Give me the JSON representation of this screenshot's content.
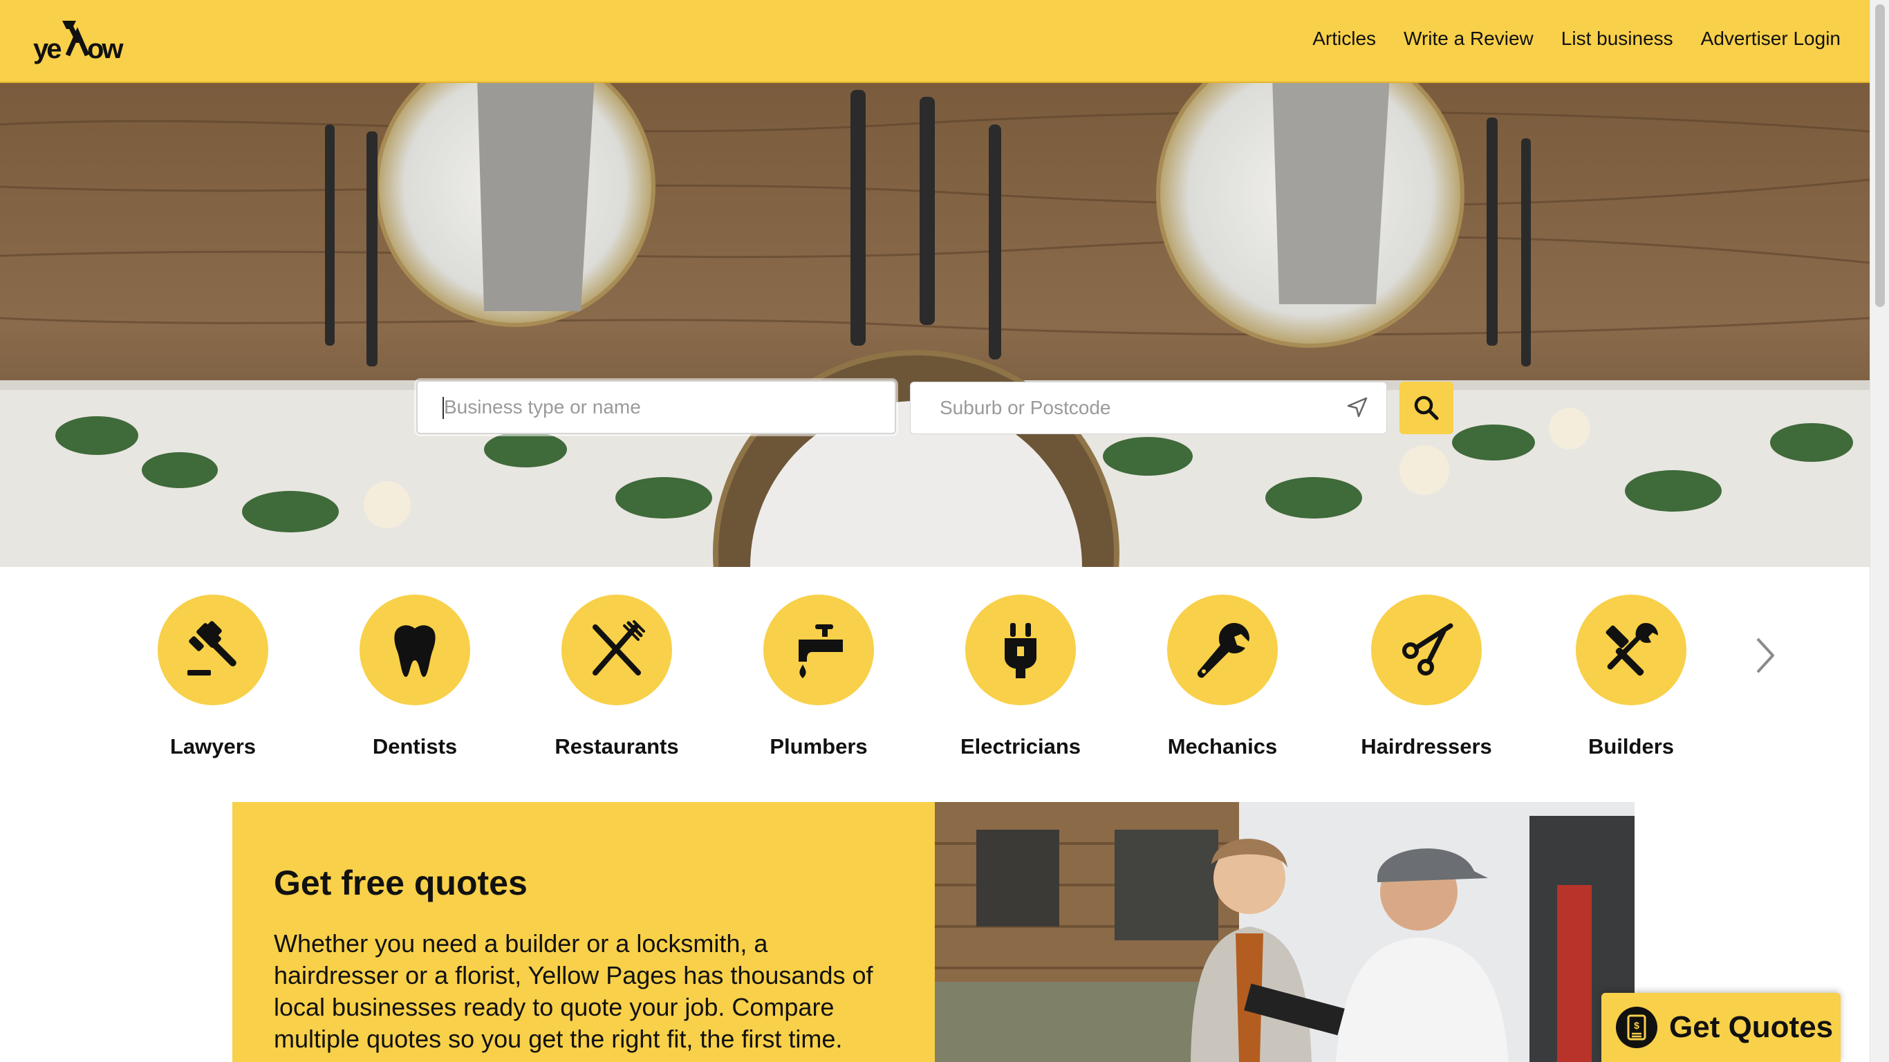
{
  "brand": {
    "logo_text": "yellow",
    "accent_color": "#f8d049"
  },
  "nav": {
    "articles": "Articles",
    "write_review": "Write a Review",
    "list_business": "List business",
    "advertiser_login": "Advertiser Login"
  },
  "search": {
    "business_placeholder": "Business type or name",
    "business_value": "",
    "location_placeholder": "Suburb or Postcode",
    "location_value": "",
    "locate_icon": "location-arrow-icon",
    "button_icon": "search-icon"
  },
  "categories": [
    {
      "label": "Lawyers",
      "icon": "gavel-icon"
    },
    {
      "label": "Dentists",
      "icon": "tooth-icon"
    },
    {
      "label": "Restaurants",
      "icon": "fork-knife-icon"
    },
    {
      "label": "Plumbers",
      "icon": "tap-icon"
    },
    {
      "label": "Electricians",
      "icon": "plug-icon"
    },
    {
      "label": "Mechanics",
      "icon": "wrench-icon"
    },
    {
      "label": "Hairdressers",
      "icon": "scissors-icon"
    },
    {
      "label": "Builders",
      "icon": "hammer-wrench-icon"
    }
  ],
  "promo": {
    "title": "Get free quotes",
    "text": "Whether you need a builder or a locksmith, a hairdresser or a florist, Yellow Pages has thousands of local businesses ready to quote your job. Compare multiple quotes so you get the right fit, the first time."
  },
  "floating_button": {
    "label": "Get Quotes",
    "icon": "quote-dollar-icon"
  }
}
